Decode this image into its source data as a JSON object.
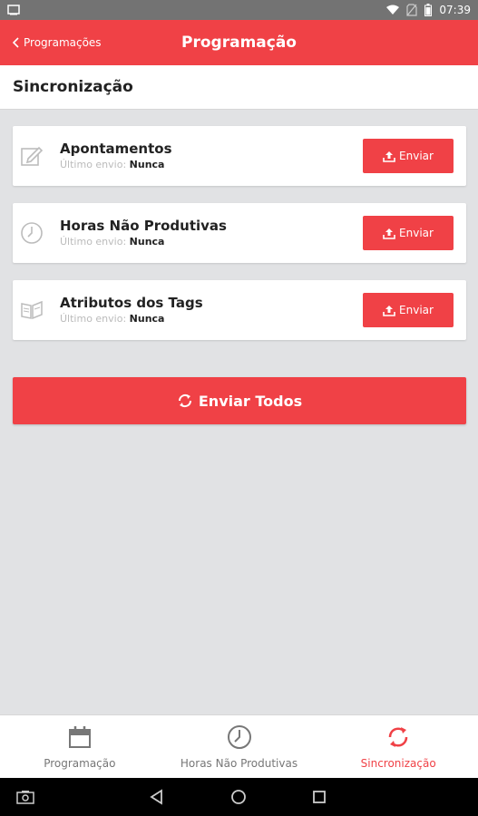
{
  "status_bar": {
    "time": "07:39"
  },
  "header": {
    "back_label": "Programações",
    "title": "Programação"
  },
  "section": {
    "title": "Sincronização"
  },
  "cards": [
    {
      "title": "Apontamentos",
      "sub_label": "Último envio:",
      "sub_value": "Nunca",
      "button": "Enviar",
      "icon": "edit-icon"
    },
    {
      "title": "Horas Não Produtivas",
      "sub_label": "Último envio:",
      "sub_value": "Nunca",
      "button": "Enviar",
      "icon": "clock-icon"
    },
    {
      "title": "Atributos dos Tags",
      "sub_label": "Último envio:",
      "sub_value": "Nunca",
      "button": "Enviar",
      "icon": "book-icon"
    }
  ],
  "send_all": "Enviar Todos",
  "tabs": [
    {
      "label": "Programação",
      "icon": "calendar-icon"
    },
    {
      "label": "Horas Não Produtivas",
      "icon": "clock-icon"
    },
    {
      "label": "Sincronização",
      "icon": "sync-icon",
      "active": true
    }
  ],
  "colors": {
    "accent": "#f04146",
    "background": "#e1e2e4"
  }
}
